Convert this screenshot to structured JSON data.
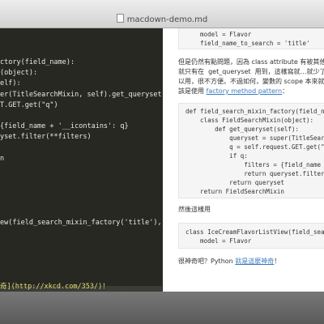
{
  "window": {
    "title": "macdown-demo.md"
  },
  "editor": {
    "lines": [
      "ctory(field_name):",
      "(object):",
      "elf):",
      "er(TitleSearchMixin, self).get_queryset()",
      "T.GET.get(\"q\")",
      "",
      "{field_name + '__icontains': q}",
      "yset.filter(**filters)",
      "",
      "n",
      "",
      "",
      "",
      "",
      "",
      "ew(field_search_mixin_factory('title'),",
      "",
      "",
      "",
      "",
      "",
      "奇](http://xkcd.com/353/)！"
    ]
  },
  "preview": {
    "top_code": [
      "    model = Flavor",
      "    field_name_to_search = 'title'"
    ],
    "para1_lines": [
      "但是仍然有點問題，因為 class attribute 有被其他人複",
      "就只有在  get_queryset  用到，這樣寫就…就少了",
      "以用，很不方便。不過如何，變數的 scope 本來就應",
      "該是使用 "
    ],
    "para1_link": "factory method pattern",
    "para1_tail": "：",
    "code2": [
      "def field_search_mixin_factory(field_name):",
      "    class FieldSearchMixin(object):",
      "        def get_queryset(self):",
      "            queryset = super(TitleSearchMixin",
      "            q = self.request.GET.get(\"q\")",
      "            if q:",
      "                filters = {field_name + '__i",
      "                return queryset.filter(**fil",
      "            return queryset",
      "    return FieldSearchMixin"
    ],
    "para2": "然後這樣用",
    "code3": [
      "class IceCreamFlavorListView(field_search_mi",
      "    model = Flavor"
    ],
    "para3_prefix": "很神奇吧？Python ",
    "para3_link": "就是這麼神奇",
    "para3_tail": "！"
  }
}
